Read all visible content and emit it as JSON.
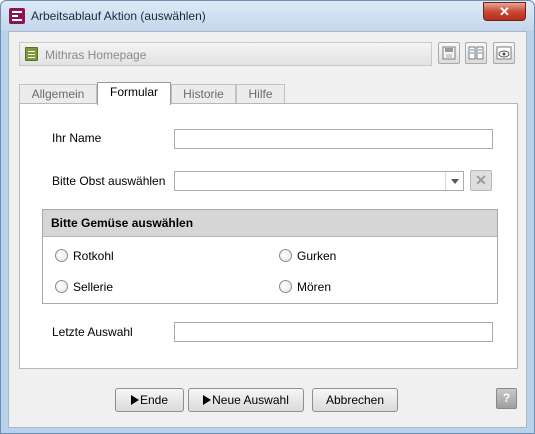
{
  "window": {
    "title": "Arbeitsablauf Aktion (auswählen)",
    "close_glyph": "✕",
    "accent": "#8b1550"
  },
  "page_field": {
    "value": "Mithras Homepage"
  },
  "toolbar": {
    "icons": [
      "save-icon",
      "compare-icon",
      "preview-icon"
    ]
  },
  "tabs": [
    {
      "label": "Allgemein",
      "active": false
    },
    {
      "label": "Formular",
      "active": true
    },
    {
      "label": "Historie",
      "active": false
    },
    {
      "label": "Hilfe",
      "active": false
    }
  ],
  "form": {
    "name_label": "Ihr Name",
    "name_value": "",
    "fruit_label": "Bitte Obst auswählen",
    "fruit_value": "",
    "clear_glyph": "✕",
    "vegetables": {
      "heading": "Bitte Gemüse auswählen",
      "options": [
        {
          "label": "Rotkohl",
          "checked": false
        },
        {
          "label": "Gurken",
          "checked": false
        },
        {
          "label": "Sellerie",
          "checked": false
        },
        {
          "label": "Mören",
          "checked": false
        }
      ]
    },
    "last_label": "Letzte Auswahl",
    "last_value": ""
  },
  "buttons": {
    "end_label": "Ende",
    "new_selection_label": "Neue Auswahl",
    "cancel_label": "Abbrechen",
    "help_glyph": "?"
  }
}
